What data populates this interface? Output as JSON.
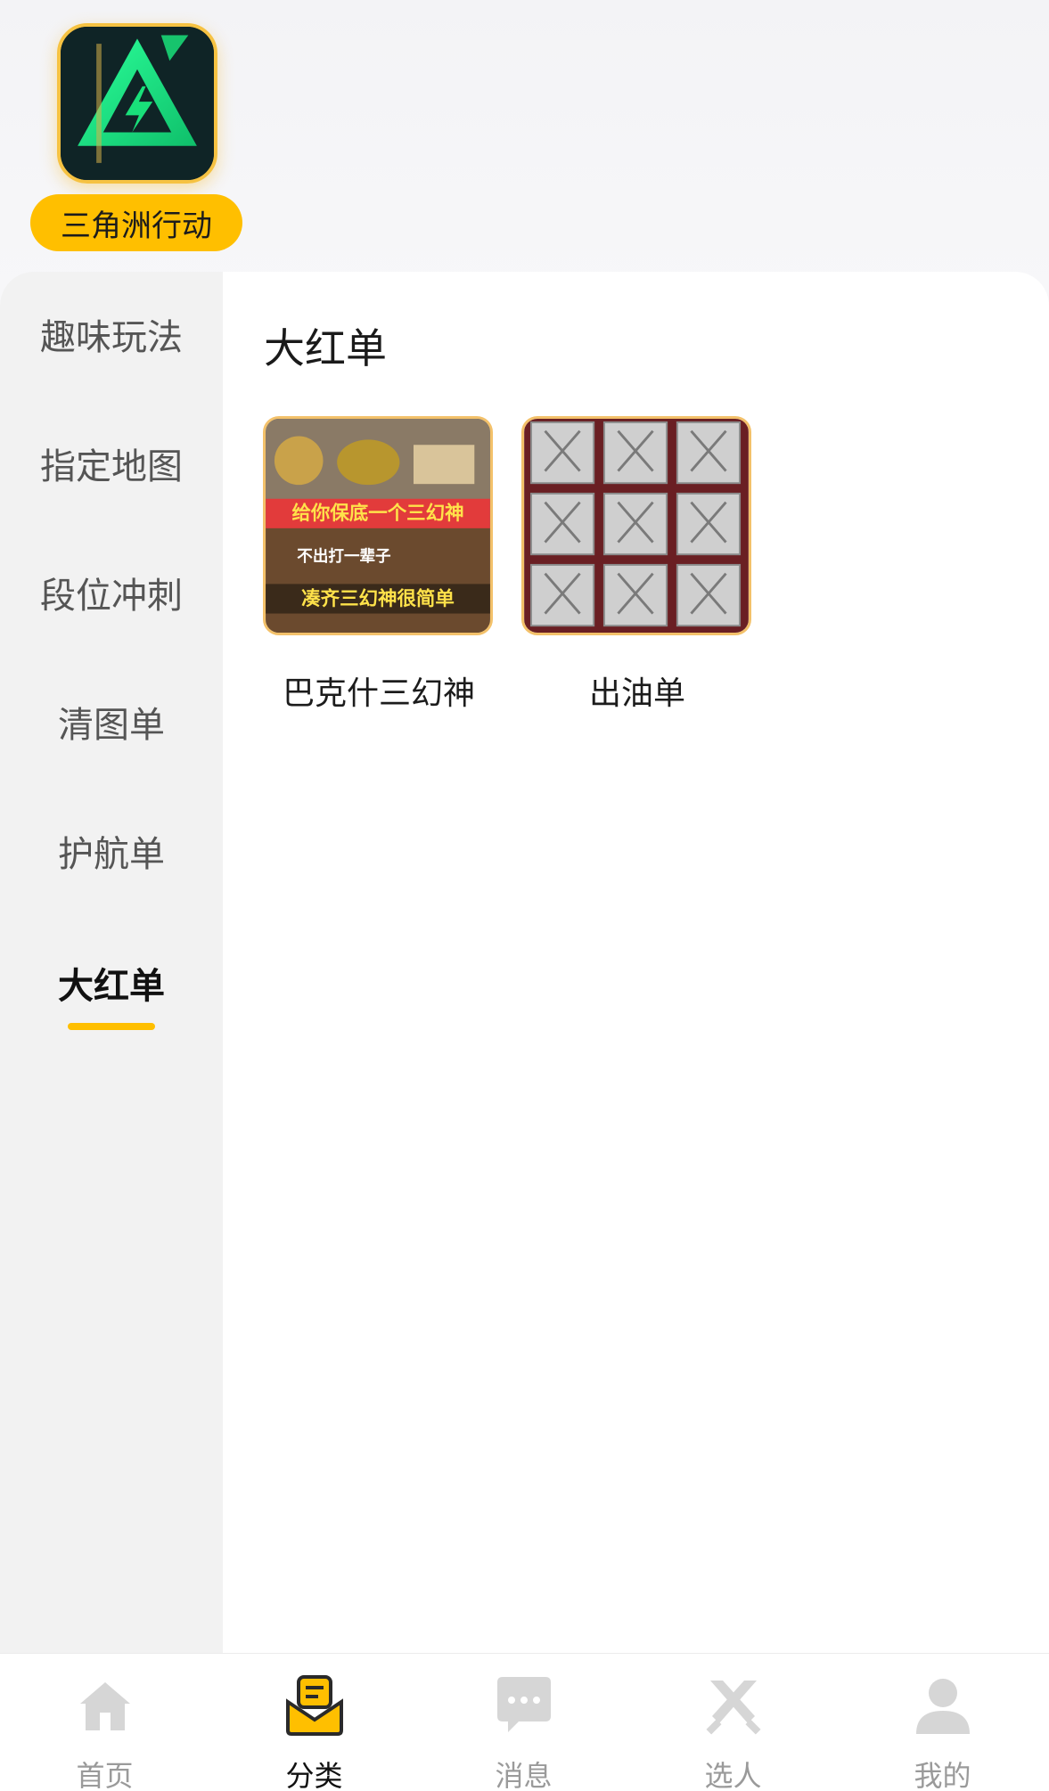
{
  "game": {
    "name": "三角洲行动",
    "logo_icon": "delta-force-triangle-logo"
  },
  "sidebar": {
    "items": [
      {
        "label": "趣味玩法",
        "active": false
      },
      {
        "label": "指定地图",
        "active": false
      },
      {
        "label": "段位冲刺",
        "active": false
      },
      {
        "label": "清图单",
        "active": false
      },
      {
        "label": "护航单",
        "active": false
      },
      {
        "label": "大红单",
        "active": true
      }
    ]
  },
  "content": {
    "title": "大红单",
    "items": [
      {
        "label": "巴克什三幻神",
        "thumb_text_1": "给你保底一个三幻神",
        "thumb_text_2": "不出打一辈子",
        "thumb_text_3": "凑齐三幻神很简单"
      },
      {
        "label": "出油单"
      }
    ]
  },
  "tabbar": {
    "tabs": [
      {
        "label": "首页",
        "icon": "home-icon",
        "active": false
      },
      {
        "label": "分类",
        "icon": "category-envelope-icon",
        "active": true
      },
      {
        "label": "消息",
        "icon": "message-bubble-icon",
        "active": false
      },
      {
        "label": "选人",
        "icon": "crossed-swords-icon",
        "active": false
      },
      {
        "label": "我的",
        "icon": "user-profile-icon",
        "active": false
      }
    ]
  },
  "colors": {
    "accent": "#ffbf00",
    "sidebar_bg": "#f2f2f2",
    "logo_green": "#19e07a"
  }
}
